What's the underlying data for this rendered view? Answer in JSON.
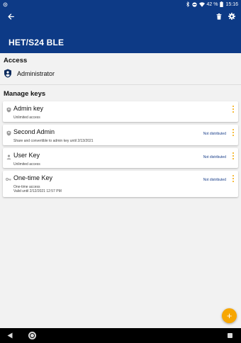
{
  "status_bar": {
    "time": "15:16",
    "battery": "42 %"
  },
  "app_bar": {
    "title": "HET/S24 BLE"
  },
  "access": {
    "header": "Access",
    "role": "Administrator"
  },
  "manage_keys": {
    "header": "Manage keys",
    "keys": [
      {
        "title": "Admin key",
        "status": "",
        "lines": [
          "Unlimited access"
        ]
      },
      {
        "title": "Second Admin",
        "status": "Not distributed",
        "lines": [
          "Share and convertible to admin key until 2/13/2021"
        ]
      },
      {
        "title": "User Key",
        "status": "Not distributed",
        "lines": [
          "Unlimited access"
        ]
      },
      {
        "title": "One-time Key",
        "status": "Not distributed",
        "lines": [
          "One-time access",
          "Valid until 2/12/2021 12:57 PM"
        ]
      }
    ]
  },
  "fab": {
    "label": "+"
  },
  "colors": {
    "primary": "#0d3a86",
    "accent": "#f7a600",
    "background": "#f2f2f2"
  }
}
